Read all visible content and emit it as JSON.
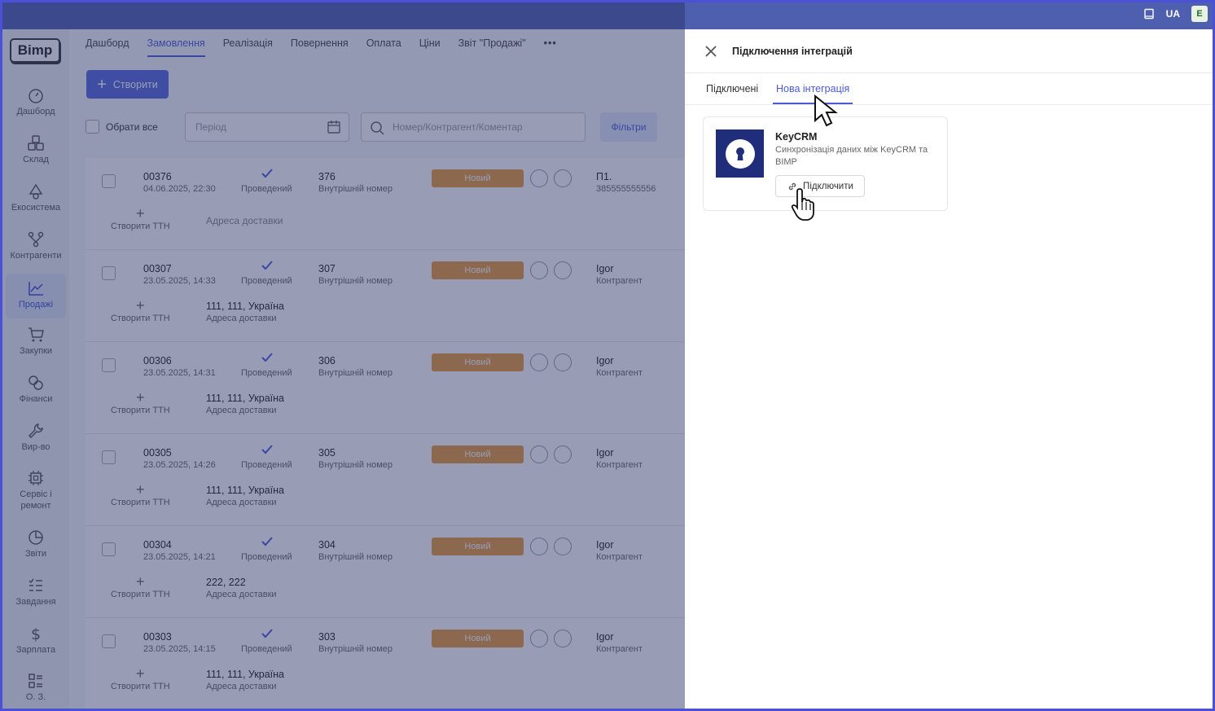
{
  "topbar": {
    "lang": "UA",
    "avatar": "E",
    "icons": [
      "book-icon"
    ]
  },
  "sidebar": {
    "logo": "Bimp",
    "items": [
      {
        "label": "Дашборд",
        "icon": "speedometer-icon"
      },
      {
        "label": "Склад",
        "icon": "boxes-icon"
      },
      {
        "label": "Екосистема",
        "icon": "ecosystem-icon"
      },
      {
        "label": "Контрагенти",
        "icon": "contractors-icon"
      },
      {
        "label": "Продажі",
        "icon": "chart-line-icon"
      },
      {
        "label": "Закупки",
        "icon": "cart-icon"
      },
      {
        "label": "Фінанси",
        "icon": "coins-icon"
      },
      {
        "label": "Вир-во",
        "icon": "wrench-icon"
      },
      {
        "label": "Сервіс і ремонт",
        "icon": "chip-icon"
      },
      {
        "label": "Звіти",
        "icon": "pie-chart-icon"
      },
      {
        "label": "Завдання",
        "icon": "checklist-icon"
      },
      {
        "label": "Зарплата",
        "icon": "dollar-icon"
      },
      {
        "label": "О. З.",
        "icon": "grid-list-icon"
      }
    ]
  },
  "main": {
    "tabs": [
      {
        "label": "Дашборд"
      },
      {
        "label": "Замовлення"
      },
      {
        "label": "Реалізація"
      },
      {
        "label": "Повернення"
      },
      {
        "label": "Оплата"
      },
      {
        "label": "Ціни"
      },
      {
        "label": "Звіт \"Продажі\""
      },
      {
        "label": "•••"
      }
    ],
    "create_label": "Створити",
    "select_all": "Обрати все",
    "period_placeholder": "Період",
    "search_placeholder": "Номер/Контрагент/Коментар",
    "filters_label": "Фільтри",
    "orders": [
      {
        "num": "00376",
        "date": "04.06.2025, 22:30",
        "status": "Проведений",
        "internal": "376",
        "internal_label": "Внутрішній номер",
        "badge": "Новий",
        "cp": "П1.",
        "cp_label": "385555555556",
        "ttn": "Створити ТТН",
        "addr": "",
        "addr_label": "Адреса доставки"
      },
      {
        "num": "00307",
        "date": "23.05.2025, 14:33",
        "status": "Проведений",
        "internal": "307",
        "internal_label": "Внутрішній номер",
        "badge": "Новий",
        "cp": "Igor",
        "cp_label": "Контрагент",
        "ttn": "Створити ТТН",
        "addr": "111, 111, Україна",
        "addr_label": "Адреса доставки"
      },
      {
        "num": "00306",
        "date": "23.05.2025, 14:31",
        "status": "Проведений",
        "internal": "306",
        "internal_label": "Внутрішній номер",
        "badge": "Новий",
        "cp": "Igor",
        "cp_label": "Контрагент",
        "ttn": "Створити ТТН",
        "addr": "111, 111, Україна",
        "addr_label": "Адреса доставки"
      },
      {
        "num": "00305",
        "date": "23.05.2025, 14:26",
        "status": "Проведений",
        "internal": "305",
        "internal_label": "Внутрішній номер",
        "badge": "Новий",
        "cp": "Igor",
        "cp_label": "Контрагент",
        "ttn": "Створити ТТН",
        "addr": "111, 111, Україна",
        "addr_label": "Адреса доставки"
      },
      {
        "num": "00304",
        "date": "23.05.2025, 14:21",
        "status": "Проведений",
        "internal": "304",
        "internal_label": "Внутрішній номер",
        "badge": "Новий",
        "cp": "Igor",
        "cp_label": "Контрагент",
        "ttn": "Створити ТТН",
        "addr": "222, 222",
        "addr_label": "Адреса доставки"
      },
      {
        "num": "00303",
        "date": "23.05.2025, 14:15",
        "status": "Проведений",
        "internal": "303",
        "internal_label": "Внутрішній номер",
        "badge": "Новий",
        "cp": "Igor",
        "cp_label": "Контрагент",
        "ttn": "Створити ТТН",
        "addr": "111, 111, Україна",
        "addr_label": "Адреса доставки"
      }
    ]
  },
  "panel": {
    "title": "Підключення інтеграцій",
    "tabs": [
      {
        "label": "Підключені"
      },
      {
        "label": "Нова інтеграція"
      }
    ],
    "card": {
      "name": "KeyCRM",
      "description": "Синхронізація даних між KeyCRM та BIMP",
      "connect_label": "Підключити",
      "logo_color": "#1f2d7a"
    }
  },
  "colors": {
    "accent": "#4a5ad8",
    "badge": "#e89a3c",
    "topbar": "#4f5fb0"
  }
}
